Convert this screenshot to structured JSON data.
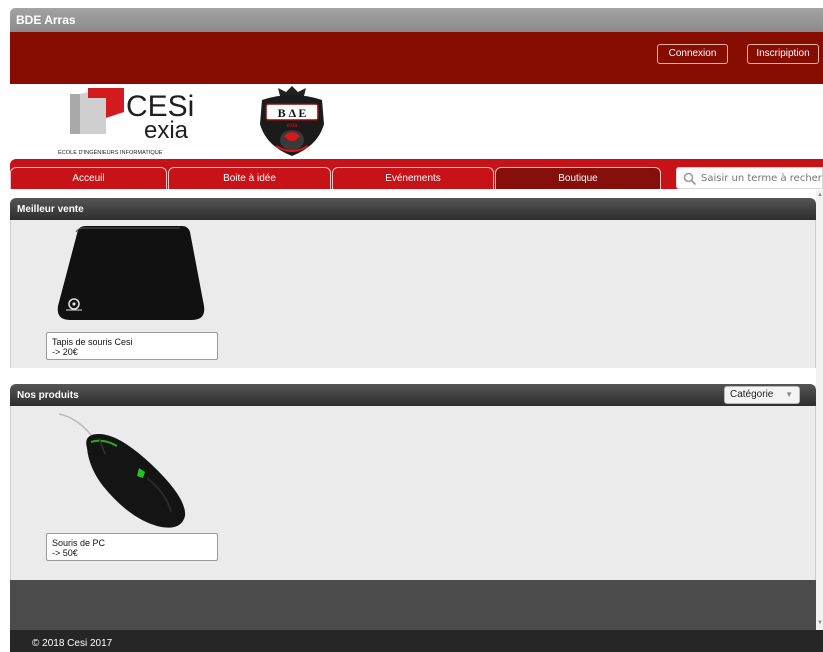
{
  "window": {
    "title": "BDE Arras"
  },
  "header": {
    "connexion_label": "Connexion",
    "inscription_label": "Inscripiption"
  },
  "logos": {
    "cesi_top": "CESi",
    "cesi_bottom": "exia",
    "cesi_tagline": "ÉCOLE D'INGÉNIEURS INFORMATIQUE",
    "bde_top": "B Δ E",
    "bde_bottom": "exia"
  },
  "nav": {
    "tabs": [
      {
        "label": "Acceuil"
      },
      {
        "label": "Boite à idée"
      },
      {
        "label": "Evénements"
      },
      {
        "label": "Boutique"
      }
    ],
    "search_placeholder": "Saisir un terme à rechercher"
  },
  "best_sellers": {
    "title": "Meilleur vente",
    "products": [
      {
        "name": "Tapis de souris Cesi",
        "price": "-> 20€"
      }
    ]
  },
  "products": {
    "title": "Nos produits",
    "category_select": "Catégorie",
    "items": [
      {
        "name": "Souris de PC",
        "price": "-> 50€"
      }
    ]
  },
  "footer": {
    "copyright": "© 2018 Cesi 2017"
  },
  "colors": {
    "header_red": "#870c02",
    "nav_red": "#c71218",
    "active_tab": "#860e0b",
    "panel_dark": "#3a3a3a"
  },
  "icons": [
    "search-icon",
    "chevron-down-icon"
  ]
}
